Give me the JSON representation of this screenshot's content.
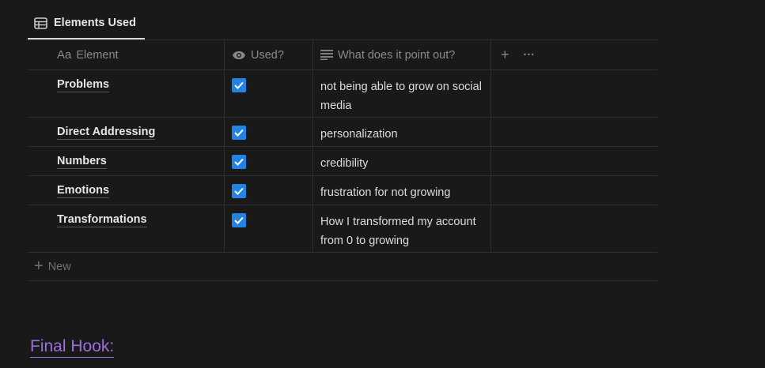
{
  "tab": {
    "label": "Elements Used",
    "icon": "table-icon"
  },
  "columns": [
    {
      "label": "Element",
      "icon": "Aa"
    },
    {
      "label": "Used?",
      "icon": "eye-icon"
    },
    {
      "label": "What does it point out?",
      "icon": "text-lines-icon"
    }
  ],
  "header_actions": {
    "add": "+",
    "more": "···"
  },
  "rows": [
    {
      "element": "Problems",
      "used": true,
      "point": "not being able to grow on social media"
    },
    {
      "element": "Direct Addressing",
      "used": true,
      "point": "personalization"
    },
    {
      "element": "Numbers",
      "used": true,
      "point": "credibility"
    },
    {
      "element": "Emotions",
      "used": true,
      "point": "frustration for not growing"
    },
    {
      "element": "Transformations",
      "used": true,
      "point": "How I transformed my account from 0 to growing"
    }
  ],
  "new_label": "New",
  "heading": "Final Hook:",
  "colors": {
    "checkbox": "#2383e2",
    "heading": "#9d6ee0",
    "background": "#191919"
  }
}
